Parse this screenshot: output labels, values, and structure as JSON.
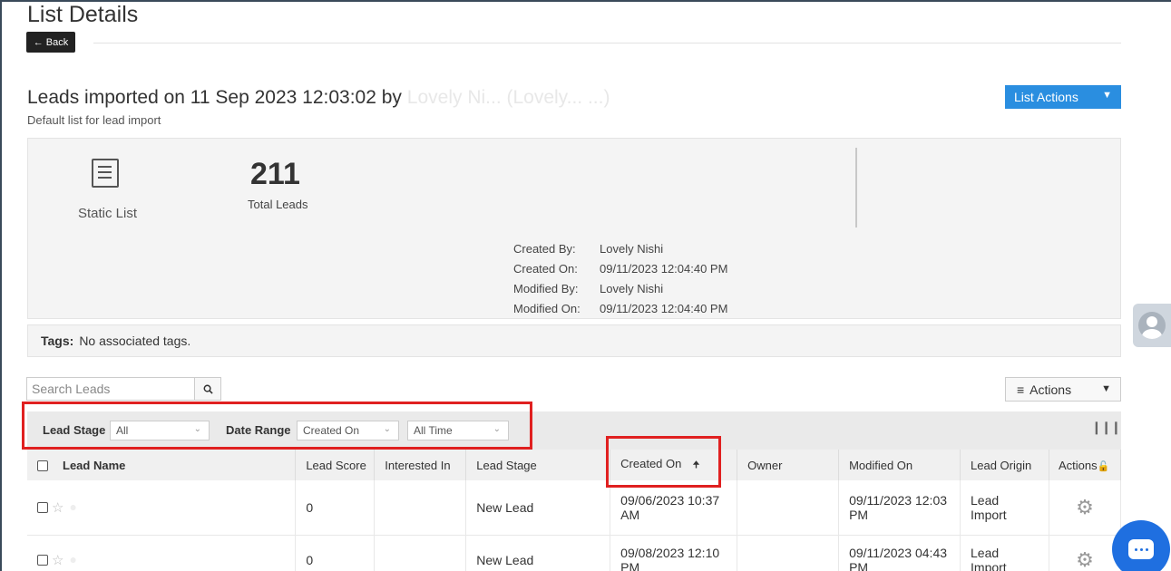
{
  "page": {
    "title": "List Details",
    "back_label": "Back"
  },
  "list": {
    "title": "Leads imported on 11 Sep 2023 12:03:02 by",
    "title_blurred": "Lovely Ni... (Lovely... ...)",
    "subtitle": "Default list for lead import",
    "actions_label": "List Actions"
  },
  "summary": {
    "type_label": "Static List",
    "total_count": "211",
    "total_label": "Total Leads",
    "meta": [
      {
        "key": "Created By:",
        "value": "Lovely Nishi"
      },
      {
        "key": "Created On:",
        "value": "09/11/2023 12:04:40 PM"
      },
      {
        "key": "Modified By:",
        "value": "Lovely Nishi"
      },
      {
        "key": "Modified On:",
        "value": "09/11/2023 12:04:40 PM"
      }
    ]
  },
  "tags": {
    "label": "Tags:",
    "value": "No associated tags."
  },
  "search": {
    "placeholder": "Search Leads"
  },
  "actions": {
    "label": "Actions"
  },
  "filters": {
    "lead_stage_label": "Lead Stage",
    "lead_stage_value": "All",
    "date_range_label": "Date Range",
    "date_field_value": "Created On",
    "date_period_value": "All Time"
  },
  "table": {
    "headers": [
      "Lead Name",
      "Lead Score",
      "Interested In",
      "Lead Stage",
      "Created On",
      "Owner",
      "Modified On",
      "Lead Origin",
      "Actions"
    ],
    "rows": [
      {
        "score": "0",
        "interested": "",
        "stage": "New Lead",
        "created_l1": "09/06/2023 10:37",
        "created_l2": "AM",
        "modified_l1": "09/11/2023 12:03",
        "modified_l2": "PM",
        "origin_l1": "Lead",
        "origin_l2": "Import"
      },
      {
        "score": "0",
        "interested": "",
        "stage": "New Lead",
        "created_l1": "09/08/2023 12:10",
        "created_l2": "PM",
        "modified_l1": "09/11/2023 04:43",
        "modified_l2": "PM",
        "origin_l1": "Lead",
        "origin_l2": "Import"
      }
    ]
  },
  "icons": {
    "back": "arrow-left-icon",
    "list": "list-icon",
    "search": "search-icon",
    "menu": "hamburger-icon",
    "columns": "columns-icon",
    "sort": "sort-up-icon",
    "lock": "lock-icon",
    "gear": "gear-icon",
    "chat": "chat-icon"
  },
  "colors": {
    "accent": "#2a8ee0",
    "highlight": "#e02020",
    "chat": "#1f6fe0"
  }
}
